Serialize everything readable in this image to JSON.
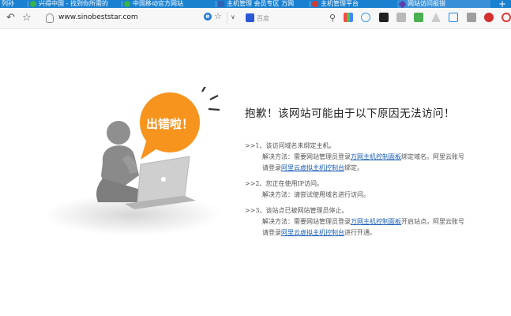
{
  "tabs": [
    {
      "label": "列孙",
      "active": false
    },
    {
      "label": "兴得中国 - 找到你所需的",
      "active": false
    },
    {
      "label": "中国移动官方网站",
      "active": false
    },
    {
      "label": "主机管理 会员专区 万网",
      "active": false
    },
    {
      "label": "主机管理平台",
      "active": false
    },
    {
      "label": "网站访问报错",
      "active": true
    }
  ],
  "new_tab_label": "+",
  "address": {
    "url": "www.sinobeststar.com"
  },
  "search": {
    "placeholder": "百度"
  },
  "error": {
    "badge": "出错啦！",
    "title": "抱歉！该网站可能由于以下原因无法访问！",
    "reasons": [
      {
        "heading": ">>1、该访问域名未绑定主机。",
        "solution_prefix": "解决方法：需要网站管理员登录",
        "link1": "万网主机控制面板",
        "solution_mid": "绑定域名。阿里云账号",
        "line2_prefix": "请登录",
        "link2": "阿里云虚拟主机控制台",
        "line2_suffix": "绑定。"
      },
      {
        "heading": ">>2、您正在使用IP访问。",
        "solution": "解决方法：请尝试使用域名进行访问。"
      },
      {
        "heading": ">>3、该站点已被网站管理员停止。",
        "solution_prefix": "解决方法：需要网站管理员登录",
        "link1": "万网主机控制面板",
        "solution_mid": "开启站点。阿里云账号",
        "line2_prefix": "请登录",
        "link2": "阿里云虚拟主机控制台",
        "line2_suffix": "进行开通。"
      }
    ]
  },
  "colors": {
    "accent_orange": "#f7941e",
    "link_blue": "#1a5db4",
    "tabbar_blue": "#1a80d0"
  }
}
